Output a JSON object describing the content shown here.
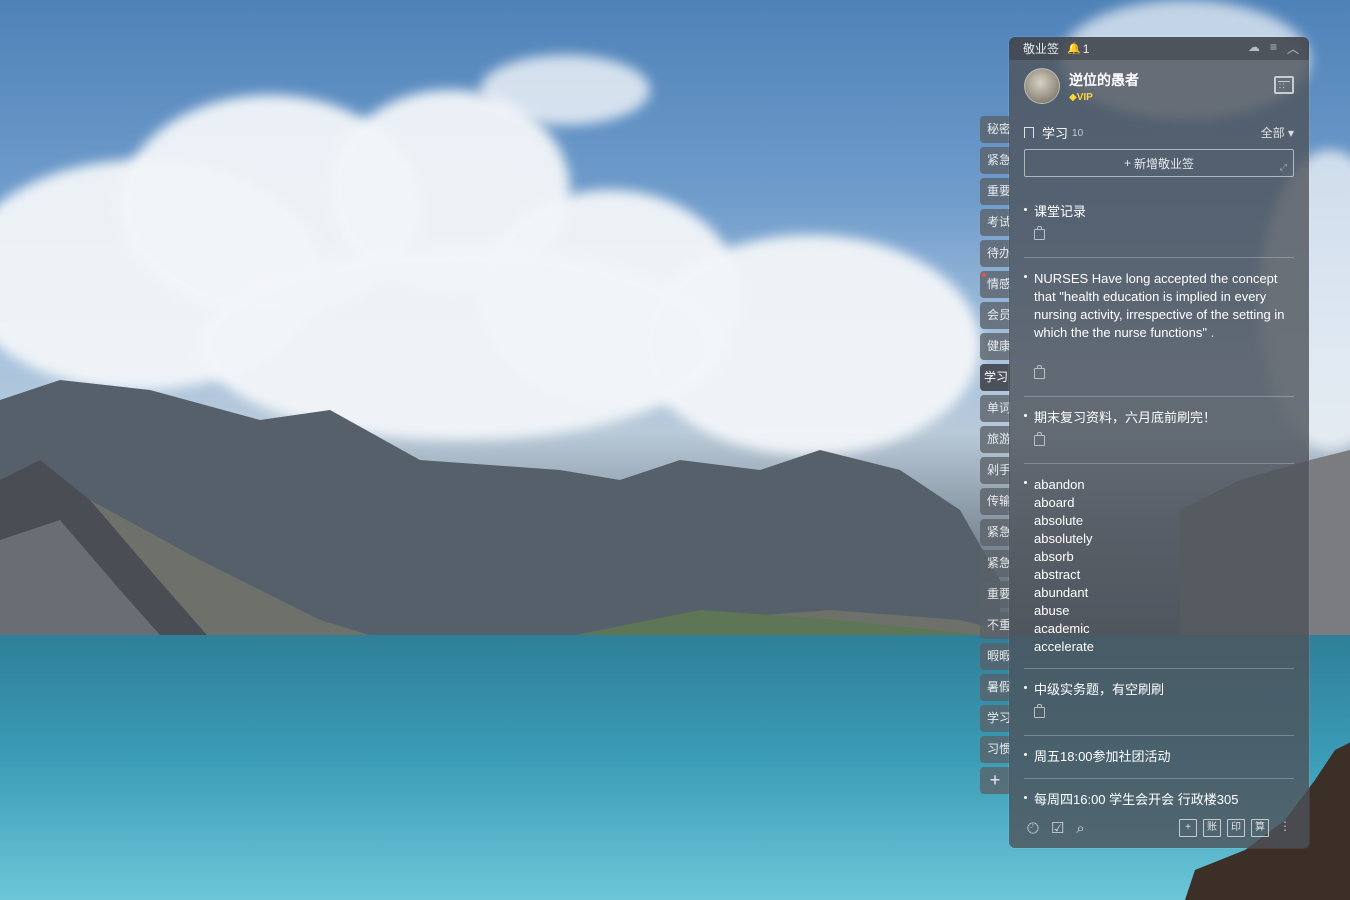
{
  "window": {
    "title": "敬业签",
    "notification_count": "1"
  },
  "user": {
    "name": "逆位的愚者",
    "vip": "VIP"
  },
  "section": {
    "name": "学习",
    "count": "10",
    "filter": "全部"
  },
  "add_button": {
    "label": "新增敬业签"
  },
  "side_tabs": [
    "秘密",
    "紧急",
    "重要",
    "考试",
    "待办",
    "情感",
    "会员",
    "健康",
    "学习",
    "单词",
    "旅游",
    "剁手",
    "传输",
    "紧急",
    "紧急",
    "重要",
    "不重",
    "暇暇",
    "暑假",
    "学习",
    "习惯"
  ],
  "active_tab_index": 8,
  "notes": [
    {
      "text": "课堂记录"
    },
    {
      "text": "NURSES Have long accepted the concept that \"health education is implied in every nursing activity, irrespective of the setting in which the the nurse functions\" ."
    },
    {
      "text": "期末复习资料，六月底前刷完！"
    },
    {
      "text": "abandon\naboard\nabsolute\nabsolutely\nabsorb\nabstract\nabundant\nabuse\nacademic\naccelerate"
    },
    {
      "text": "中级实务题，有空刷刷"
    },
    {
      "text": "周五18:00参加社团活动"
    },
    {
      "text": "每周四16:00 学生会开会 行政楼305"
    }
  ],
  "bottom_bar": {
    "tools": [
      "账",
      "印",
      "算"
    ]
  }
}
